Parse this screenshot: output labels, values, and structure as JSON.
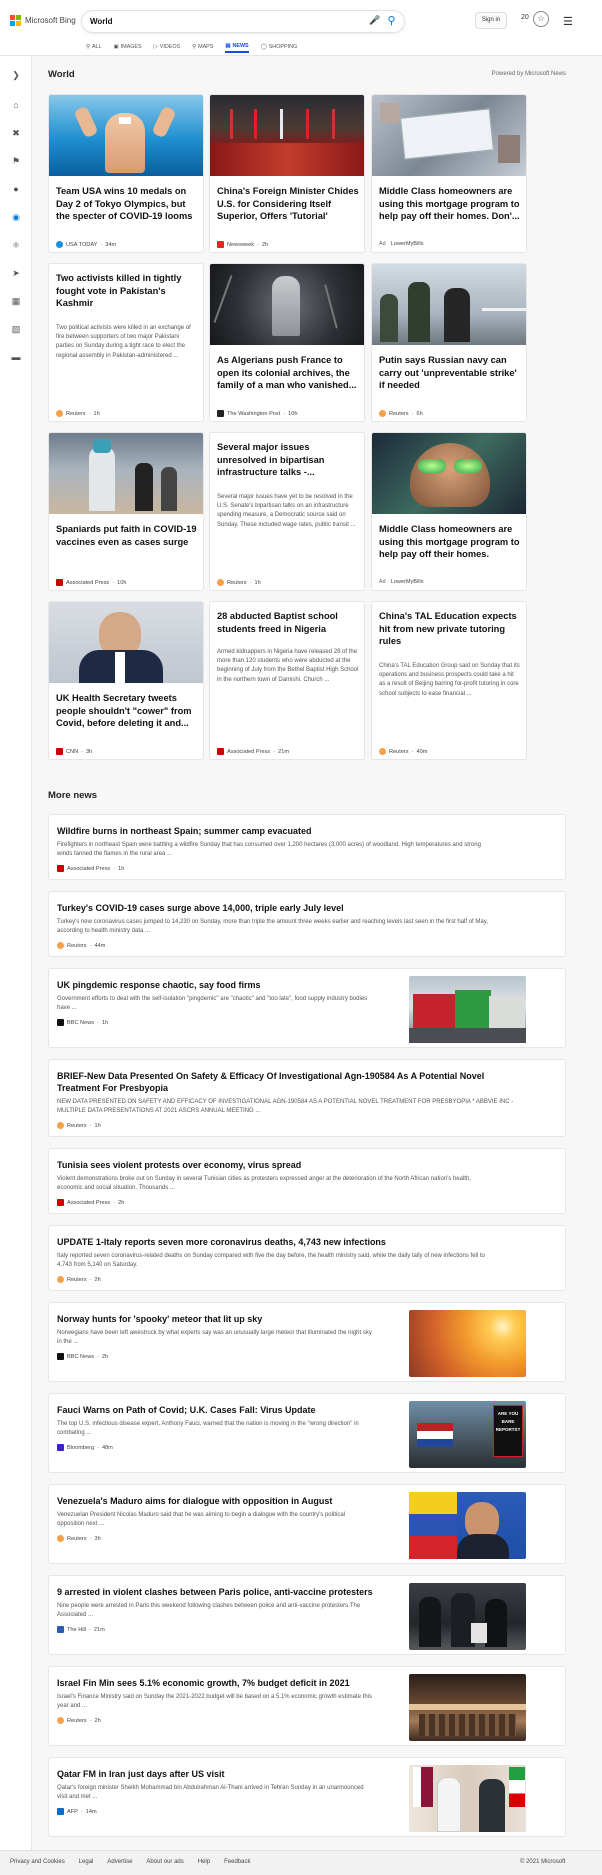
{
  "header": {
    "logo_text": "Microsoft Bing",
    "query": "World",
    "signin_label": "Sign in",
    "rewards_count": "20",
    "menu_icon": "hamburger-icon"
  },
  "nav": {
    "tabs": [
      {
        "label": "ALL",
        "icon": "search-icon"
      },
      {
        "label": "IMAGES",
        "icon": "image-icon"
      },
      {
        "label": "VIDEOS",
        "icon": "video-icon"
      },
      {
        "label": "MAPS",
        "icon": "map-pin-icon"
      },
      {
        "label": "NEWS",
        "icon": "news-icon",
        "active": true
      },
      {
        "label": "SHOPPING",
        "icon": "tag-icon"
      }
    ]
  },
  "sidebar": {
    "items": [
      "chevron-right-icon",
      "home-icon",
      "tools-icon",
      "flag-icon",
      "location-icon",
      "globe-icon",
      "science-icon",
      "rocket-icon",
      "film-icon",
      "briefcase-icon",
      "card-icon"
    ],
    "active_index": 5
  },
  "section": {
    "title": "World",
    "powered_by": "Powered by Microsoft News"
  },
  "cards": [
    {
      "title": "Team USA wins 10 medals on Day 2 of Tokyo Olympics, but the specter of COVID-19 looms",
      "source": "USA TODAY",
      "time": "34m",
      "has_image": true
    },
    {
      "title": "China's Foreign Minister Chides U.S. for Considering Itself Superior, Offers 'Tutorial'",
      "source": "Newsweek",
      "time": "2h",
      "has_image": true
    },
    {
      "title": "Middle Class homeowners are using this mortgage program to help pay off their homes. Don'...",
      "source": "LowerMyBills",
      "ad_label": "Ad",
      "has_image": true
    },
    {
      "title": "Two activists killed in tightly fought vote in Pakistan's Kashmir",
      "desc": "Two political activists were killed in an exchange of fire between supporters of two major Pakistani parties on Sunday during a tight race to elect the regional assembly in Pakistan-administered ...",
      "source": "Reuters",
      "time": "1h",
      "has_image": false
    },
    {
      "title": "As Algerians push France to open its colonial archives, the family of a man who vanished...",
      "source": "The Washington Post",
      "time": "10h",
      "has_image": true
    },
    {
      "title": "Putin says Russian navy can carry out 'unpreventable strike' if needed",
      "source": "Reuters",
      "time": "6h",
      "has_image": true
    },
    {
      "title": "Spaniards put faith in COVID-19 vaccines even as cases surge",
      "source": "Associated Press",
      "time": "10h",
      "has_image": true
    },
    {
      "title": "Several major issues unresolved in bipartisan infrastructure talks -...",
      "desc": "Several major issues have yet to be resolved in the U.S. Senate's bipartisan talks on an infrastructure spending measure, a Democratic source said on Sunday. These included wage rates, public transit ...",
      "source": "Reuters",
      "time": "1h",
      "has_image": false
    },
    {
      "title": "Middle Class homeowners are using this mortgage program to help pay off their homes.",
      "source": "LowerMyBills",
      "ad_label": "Ad",
      "has_image": true
    },
    {
      "title": "UK Health Secretary tweets people shouldn't \"cower\" from Covid, before deleting it and...",
      "source": "CNN",
      "time": "3h",
      "has_image": true
    },
    {
      "title": "28 abducted Baptist school students freed in Nigeria",
      "desc": "Armed kidnappers in Nigeria have released 28 of the more than 120 students who were abducted at the beginning of July from the Bethel Baptist High School in the northern town of Damishi. Church ...",
      "source": "Associated Press",
      "time": "21m",
      "has_image": false
    },
    {
      "title": "China's TAL Education expects hit from new private tutoring rules",
      "desc": "China's TAL Education Group said on Sunday that its operations and business prospects could take a hit as a result of Beijing barring for-profit tutoring in core school subjects to ease financial ...",
      "source": "Reuters",
      "time": "40m",
      "has_image": false
    }
  ],
  "more_news": {
    "title": "More news",
    "items": [
      {
        "title": "Wildfire burns in northeast Spain; summer camp evacuated",
        "desc1": "Firefighters in northeast Spain were battling a wildfire Sunday that has consumed over 1,200 hectares (3,000 acres) of woodland. High temperatures and strong",
        "desc2": "winds fanned the flames in the rural area ...",
        "source": "Associated Press",
        "time": "1h"
      },
      {
        "title": "Turkey's COVID-19 cases surge above 14,000, triple early July level",
        "desc1": "Turkey's new coronavirus cases jumped to 14,230 on Sunday, more than triple the amount three weeks earlier and reaching levels last seen in the first half of May,",
        "desc2": "according to health ministry data ...",
        "source": "Reuters",
        "time": "44m"
      },
      {
        "title": "UK pingdemic response chaotic, say food firms",
        "desc1": "Government efforts to deal with the self-isolation \"pingdemic\" are \"chaotic\" and \"too late\", food supply industry bodies",
        "desc2": "have ...",
        "source": "BBC News",
        "time": "1h",
        "thumb": true
      },
      {
        "title": "BRIEF-New Data Presented On Safety & Efficacy Of Investigational Agn-190584 As A Potential Novel",
        "title2": "Treatment For Presbyopia",
        "desc1": "NEW DATA PRESENTED ON SAFETY AND EFFICACY OF INVESTIGATIONAL AGN-190584 AS A POTENTIAL NOVEL TREATMENT FOR PRESBYOPIA * ABBVIE INC -",
        "desc2": "MULTIPLE DATA PRESENTATIONS AT 2021 ASCRS ANNUAL MEETING ...",
        "source": "Reuters",
        "time": "1h"
      },
      {
        "title": "Tunisia sees violent protests over economy, virus spread",
        "desc1": "Violent demonstrations broke out on Sunday in several Tunisian cities as protesters expressed anger at the deterioration of the North African nation's health,",
        "desc2": "economic and social situation. Thousands ...",
        "source": "Associated Press",
        "time": "2h"
      },
      {
        "title": "UPDATE 1-Italy reports seven more coronavirus deaths, 4,743 new infections",
        "desc1": "Italy reported seven coronavirus-related deaths on Sunday compared with five the day before, the health ministry said, while the daily tally of new infections fell to",
        "desc2": "4,743 from 5,140 on Saturday.",
        "source": "Reuters",
        "time": "2h"
      },
      {
        "title": "Norway hunts for 'spooky' meteor that lit up sky",
        "desc1": "Norwegians have been left awestruck by what experts say was an unusually large meteor that illuminated the night sky",
        "desc2": "in the ...",
        "source": "BBC News",
        "time": "2h",
        "thumb": true
      },
      {
        "title": "Fauci Warns on Path of Covid; U.K. Cases Fall: Virus Update",
        "desc1": "The top U.S. infectious disease expert, Anthony Fauci, warned that the nation is moving in the \"wrong direction\" in",
        "desc2": "combating ...",
        "source": "Bloomberg",
        "time": "48m",
        "thumb": true,
        "thumb_text1": "ARE YOU",
        "thumb_text2": "BARE",
        "thumb_text3": "REPORTS?"
      },
      {
        "title": "Venezuela's Maduro aims for dialogue with opposition in August",
        "desc1": "Venezuelan President Nicolas Maduro said that he was aiming to begin a dialogue with the country's political",
        "desc2": "opposition next ...",
        "source": "Reuters",
        "time": "3h",
        "thumb": true
      },
      {
        "title": "9 arrested in violent clashes between Paris police, anti-vaccine protesters",
        "desc1": "Nine people were arrested in Paris this weekend following clashes between police and anti-vaccine protesters.The",
        "desc2": "Associated ...",
        "source": "The Hill",
        "time": "21m",
        "thumb": true
      },
      {
        "title": "Israel Fin Min sees 5.1% economic growth, 7% budget deficit in 2021",
        "desc1": "Israel's Finance Ministry said on Sunday the 2021-2022 budget will be based on a 5.1% economic growth estimate this",
        "desc2": "year and ...",
        "source": "Reuters",
        "time": "2h",
        "thumb": true
      },
      {
        "title": "Qatar FM in Iran just days after US visit",
        "desc1": "Qatar's foreign minister Sheikh Mohammad bin Abdulrahman Al-Thani arrived in Tehran Sunday in an unannounced",
        "desc2": "visit and met ...",
        "source": "AFP",
        "time": "14m",
        "thumb": true
      }
    ]
  },
  "footer": {
    "links": [
      "Privacy and Cookies",
      "Legal",
      "Advertise",
      "About our ads",
      "Help",
      "Feedback"
    ],
    "copyright": "© 2021 Microsoft"
  }
}
